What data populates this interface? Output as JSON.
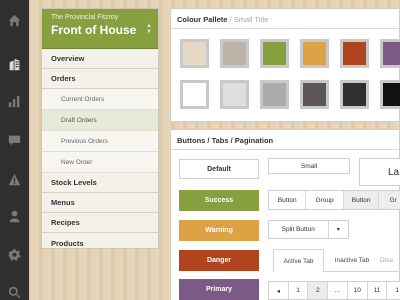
{
  "rail": {
    "items": [
      {
        "icon": "home-icon"
      },
      {
        "icon": "building-icon",
        "active": true
      },
      {
        "icon": "bar-chart-icon"
      },
      {
        "icon": "chat-icon"
      },
      {
        "icon": "warning-icon"
      },
      {
        "icon": "user-icon"
      },
      {
        "icon": "gear-icon"
      },
      {
        "icon": "search-icon"
      }
    ]
  },
  "nav": {
    "subtitle": "The Provincial Fitzroy",
    "title": "Front of House",
    "items": {
      "overview": "Overview",
      "orders": "Orders",
      "current_orders": "Current Orders",
      "draft_orders": "Draft Orders",
      "previous_orders": "Previous Orders",
      "new_order": "New Order",
      "stock_levels": "Stock Levels",
      "menus": "Menus",
      "recipes": "Recipes",
      "products": "Products"
    }
  },
  "palette": {
    "title": "Colour Pallete",
    "separator": " / ",
    "subtitle": "Small Title",
    "colors_row1": [
      "#e6d9c8",
      "#bdb3a8",
      "#86a03f",
      "#dca244",
      "#b1431f",
      "#7b5a86"
    ],
    "colors_row2": [
      "#ffffff",
      "#dedede",
      "#ababab",
      "#5d5556",
      "#2f2f2f",
      "#111111"
    ]
  },
  "buttons": {
    "title": "Buttons / Tabs / Pagination",
    "default": "Default",
    "success": "Success",
    "warning": "Warning",
    "danger": "Danger",
    "primary": "Primary",
    "small": "Small",
    "large_partial": "La",
    "group1": [
      "Button",
      "Group",
      "Button",
      "Gr"
    ],
    "split": "Split Button",
    "split_caret": "▾",
    "tabs": [
      "Active Tab",
      "Inactive Tab",
      "Disa"
    ],
    "pagination": [
      "◂",
      "1",
      "2",
      "...",
      "10",
      "11",
      "1"
    ]
  },
  "colors": {
    "success": "#86a03f",
    "warning": "#dca244",
    "danger": "#b1431f",
    "primary": "#7b5a86"
  }
}
